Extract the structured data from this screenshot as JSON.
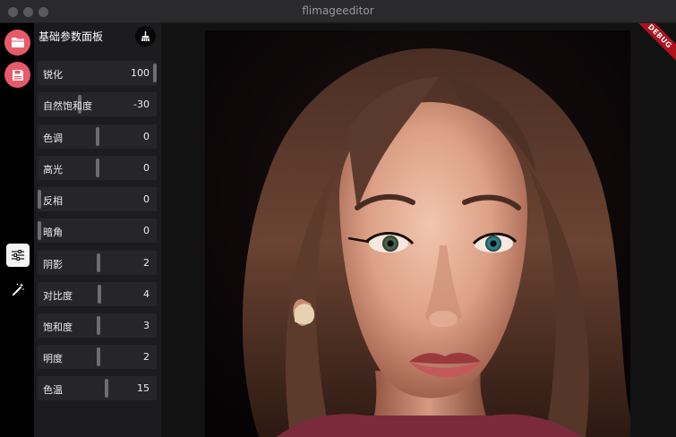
{
  "window": {
    "title": "flimageeditor"
  },
  "rail": {
    "open_icon": "folder-icon",
    "save_icon": "save-icon",
    "adjust_icon": "sliders-icon",
    "magic_icon": "magic-wand-icon",
    "accent_color": "#e85a6a"
  },
  "panel": {
    "title": "基础参数面板",
    "clear_icon": "broom-icon",
    "params": [
      {
        "label": "锐化",
        "value": "100",
        "level": 1.0
      },
      {
        "label": "自然饱和度",
        "value": "-30",
        "level": 0.35
      },
      {
        "label": "色调",
        "value": "0",
        "level": 0.5
      },
      {
        "label": "高光",
        "value": "0",
        "level": 0.5
      },
      {
        "label": "反相",
        "value": "0",
        "level": 0.0
      },
      {
        "label": "暗角",
        "value": "0",
        "level": 0.0
      },
      {
        "label": "阴影",
        "value": "2",
        "level": 0.51
      },
      {
        "label": "对比度",
        "value": "4",
        "level": 0.52
      },
      {
        "label": "饱和度",
        "value": "3",
        "level": 0.51
      },
      {
        "label": "明度",
        "value": "2",
        "level": 0.51
      },
      {
        "label": "色温",
        "value": "15",
        "level": 0.58
      }
    ]
  },
  "canvas": {
    "debug_banner": "DEBUG",
    "image": "portrait-photo"
  }
}
